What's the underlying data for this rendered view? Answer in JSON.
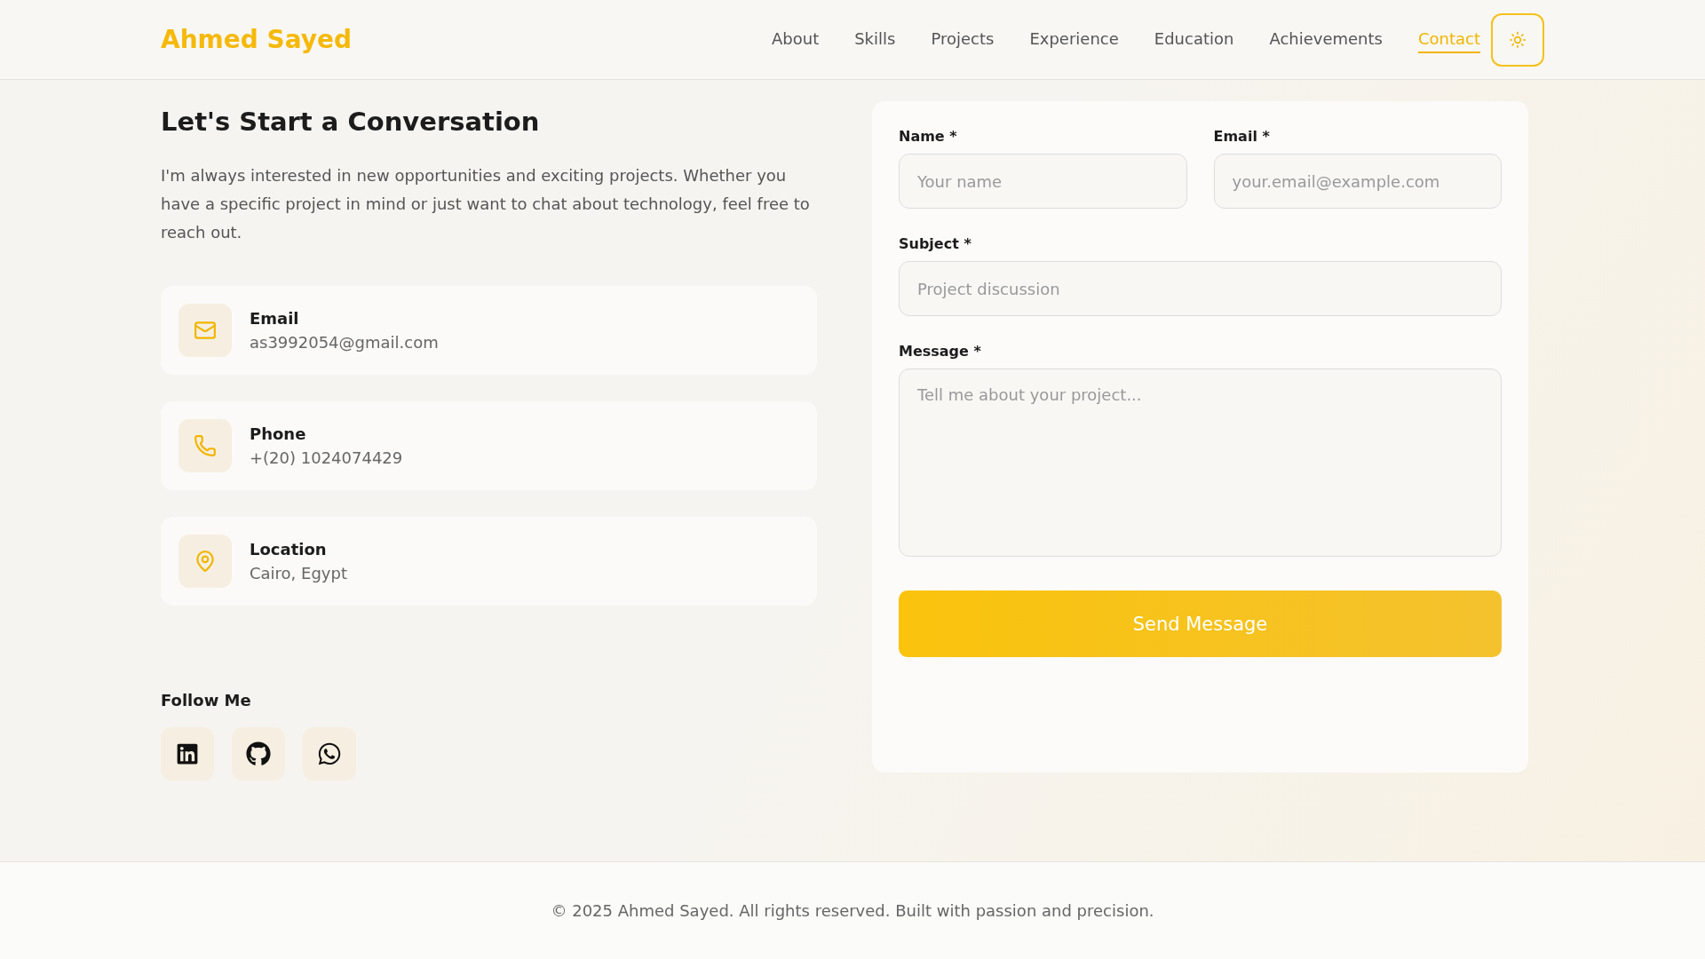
{
  "header": {
    "logo": "Ahmed Sayed",
    "nav": [
      {
        "label": "About",
        "selected": false
      },
      {
        "label": "Skills",
        "selected": false
      },
      {
        "label": "Projects",
        "selected": false
      },
      {
        "label": "Experience",
        "selected": false
      },
      {
        "label": "Education",
        "selected": false
      },
      {
        "label": "Achievements",
        "selected": false
      },
      {
        "label": "Contact",
        "selected": true
      }
    ]
  },
  "intro": {
    "title": "Let's Start a Conversation",
    "text": "I'm always interested in new opportunities and exciting projects. Whether you have a specific project in mind or just want to chat about technology, feel free to reach out."
  },
  "contacts": [
    {
      "kind": "email",
      "label": "Email",
      "value": "as3992054@gmail.com"
    },
    {
      "kind": "phone",
      "label": "Phone",
      "value": "+(20) 1024074429"
    },
    {
      "kind": "location",
      "label": "Location",
      "value": "Cairo, Egypt"
    }
  ],
  "follow": {
    "title": "Follow Me",
    "links": [
      {
        "kind": "linkedin"
      },
      {
        "kind": "github"
      },
      {
        "kind": "whatsapp"
      }
    ]
  },
  "form": {
    "fields": [
      {
        "kind": "input",
        "label": "Name *",
        "placeholder": "Your name"
      },
      {
        "kind": "input",
        "label": "Email *",
        "placeholder": "your.email@example.com"
      },
      {
        "kind": "input",
        "label": "Subject *",
        "placeholder": "Project discussion"
      },
      {
        "kind": "textarea",
        "label": "Message *",
        "placeholder": "Tell me about your project..."
      }
    ],
    "submit": "Send Message"
  },
  "footer": {
    "text": "© 2025 Ahmed Sayed. All rights reserved. Built with passion and precision."
  }
}
